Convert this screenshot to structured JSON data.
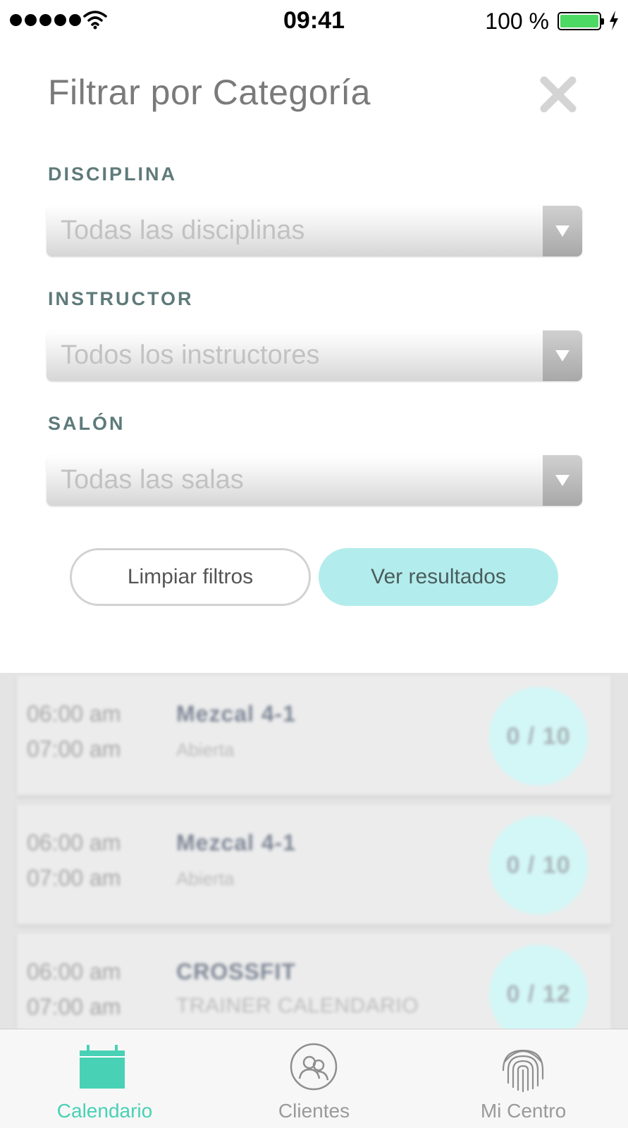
{
  "status_bar": {
    "time": "09:41",
    "battery": "100 %",
    "battery_level": 1.0
  },
  "header": {
    "title": "Filtrar por Categoría",
    "close_icon": "close-icon"
  },
  "filters": [
    {
      "label": "DISCIPLINA",
      "value": "Todas las disciplinas"
    },
    {
      "label": "INSTRUCTOR",
      "value": "Todos los instructores"
    },
    {
      "label": "SALÓN",
      "value": "Todas las salas"
    }
  ],
  "buttons": {
    "clear": "Limpiar filtros",
    "results": "Ver resultados"
  },
  "background_list": [
    {
      "start": "06:00 am",
      "end": "07:00 am",
      "name": "Mezcal 4-1",
      "subtitle": "Abierta",
      "capacity": "0 / 10"
    },
    {
      "start": "06:00 am",
      "end": "07:00 am",
      "name": "Mezcal 4-1",
      "subtitle": "Abierta",
      "capacity": "0 / 10"
    },
    {
      "start": "06:00 am",
      "end": "07:00 am",
      "name": "CROSSFIT",
      "subtitle": "TRAINER CALENDARIO",
      "capacity": "0 / 12"
    }
  ],
  "tab_bar": {
    "tabs": [
      {
        "label": "Calendario",
        "icon": "calendar-icon",
        "active": true
      },
      {
        "label": "Clientes",
        "icon": "clients-icon",
        "active": false
      },
      {
        "label": "Mi Centro",
        "icon": "fingerprint-icon",
        "active": false
      }
    ]
  },
  "colors": {
    "accent": "#48d1b4",
    "results_button": "#b3ecec",
    "label": "#5f7a7a"
  }
}
